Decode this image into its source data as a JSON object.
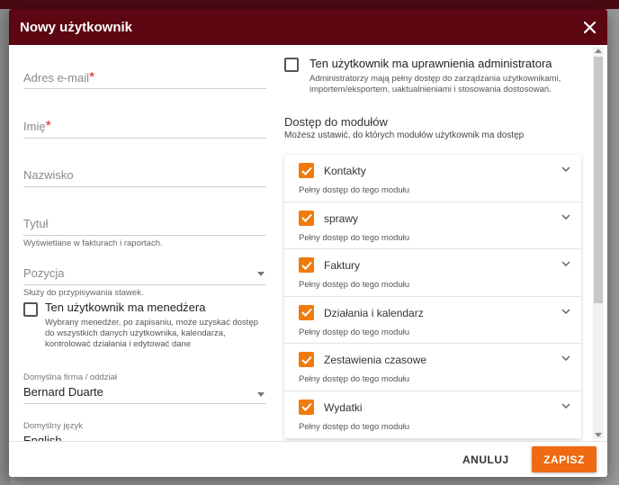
{
  "modal": {
    "title": "Nowy użytkownik",
    "close_icon": "close-icon"
  },
  "form": {
    "email": {
      "label": "Adres e-mail",
      "required": "*"
    },
    "first_name": {
      "label": "Imię",
      "required": "*"
    },
    "last_name": {
      "label": "Nazwisko"
    },
    "title": {
      "label": "Tytuł",
      "hint": "Wyświetlane w fakturach i raportach."
    },
    "position": {
      "label": "Pozycja",
      "hint": "Służy do przypisywania stawek."
    },
    "manager": {
      "label": "Ten użytkownik ma menedżera",
      "description": "Wybrany menedżer, po zapisaniu, może uzyskać dostęp do wszystkich danych użytkownika, kalendarza, kontrolować działania i edytować dane"
    },
    "company": {
      "label": "Domyślna firma / oddział",
      "value": "Bernard Duarte"
    },
    "language": {
      "label": "Domyślny język",
      "value": "English"
    }
  },
  "admin": {
    "label": "Ten użytkownik ma uprawnienia administratora",
    "description": "Administratorzy mają pełny dostęp do zarządzania użytkownikami, importem/eksportem, uaktualnieniami i stosowania dostosowań."
  },
  "modules": {
    "title": "Dostęp do modułów",
    "subtitle": "Możesz ustawić, do których modułów użytkownik ma dostęp",
    "items": [
      {
        "name": "Kontakty",
        "desc": "Pełny dostęp do tego modułu"
      },
      {
        "name": "sprawy",
        "desc": "Pełny dostęp do tego modułu"
      },
      {
        "name": "Faktury",
        "desc": "Pełny dostęp do tego modułu"
      },
      {
        "name": "Działania i kalendarz",
        "desc": "Pełny dostęp do tego modułu"
      },
      {
        "name": "Zestawienia czasowe",
        "desc": "Pełny dostęp do tego modułu"
      },
      {
        "name": "Wydatki",
        "desc": "Pełny dostęp do tego modułu"
      }
    ]
  },
  "footer": {
    "cancel": "ANULUJ",
    "save": "ZAPISZ"
  },
  "colors": {
    "header": "#5b0611",
    "accent": "#ef6a10",
    "required": "#e02020"
  }
}
